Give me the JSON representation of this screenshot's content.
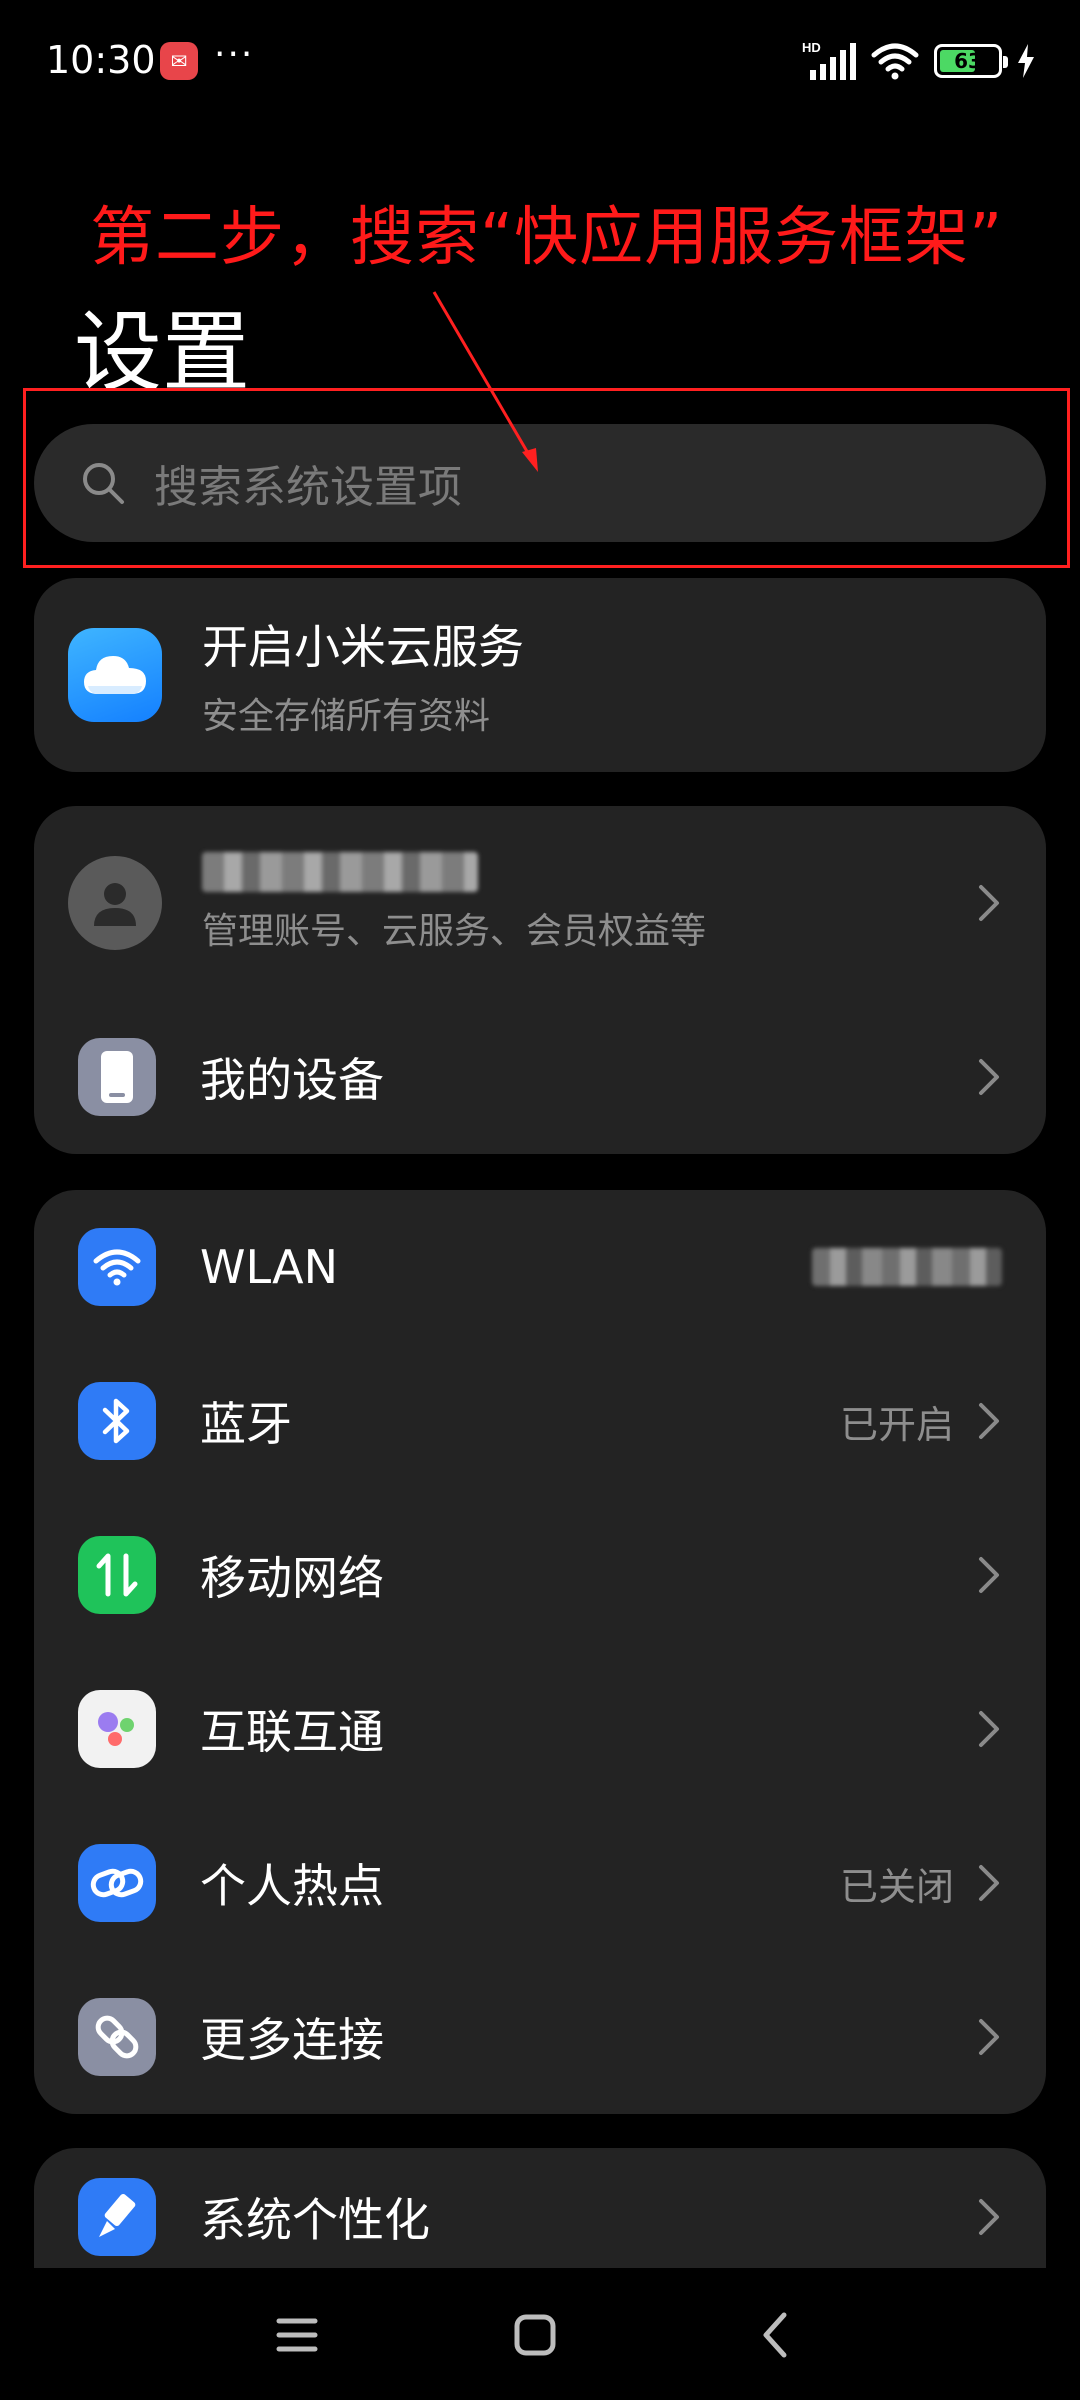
{
  "status_bar": {
    "time": "10:30",
    "dots": "···",
    "network_label": "HD",
    "battery_level": "63",
    "battery_fraction": 0.63
  },
  "annotation": {
    "text": "第二步，搜索“快应用服务框架”",
    "color": "#ff1a1a"
  },
  "page": {
    "title": "设置"
  },
  "search": {
    "placeholder": "搜索系统设置项"
  },
  "cloud": {
    "title": "开启小米云服务",
    "subtitle": "安全存储所有资料"
  },
  "account": {
    "subtitle": "管理账号、云服务、会员权益等"
  },
  "device": {
    "label": "我的设备"
  },
  "network": {
    "items": [
      {
        "label": "WLAN",
        "value": "",
        "icon": "wifi-icon",
        "color": "#2f7bf6"
      },
      {
        "label": "蓝牙",
        "value": "已开启",
        "icon": "bluetooth-icon",
        "color": "#2f7bf6"
      },
      {
        "label": "移动网络",
        "value": "",
        "icon": "mobile-data-icon",
        "color": "#1fc35a"
      },
      {
        "label": "互联互通",
        "value": "",
        "icon": "interconnect-icon",
        "color": "#f2f2f2"
      },
      {
        "label": "个人热点",
        "value": "已关闭",
        "icon": "hotspot-icon",
        "color": "#2f7bf6"
      },
      {
        "label": "更多连接",
        "value": "",
        "icon": "more-connections-icon",
        "color": "#8a8fa3"
      }
    ]
  },
  "personalization": {
    "label": "系统个性化"
  }
}
